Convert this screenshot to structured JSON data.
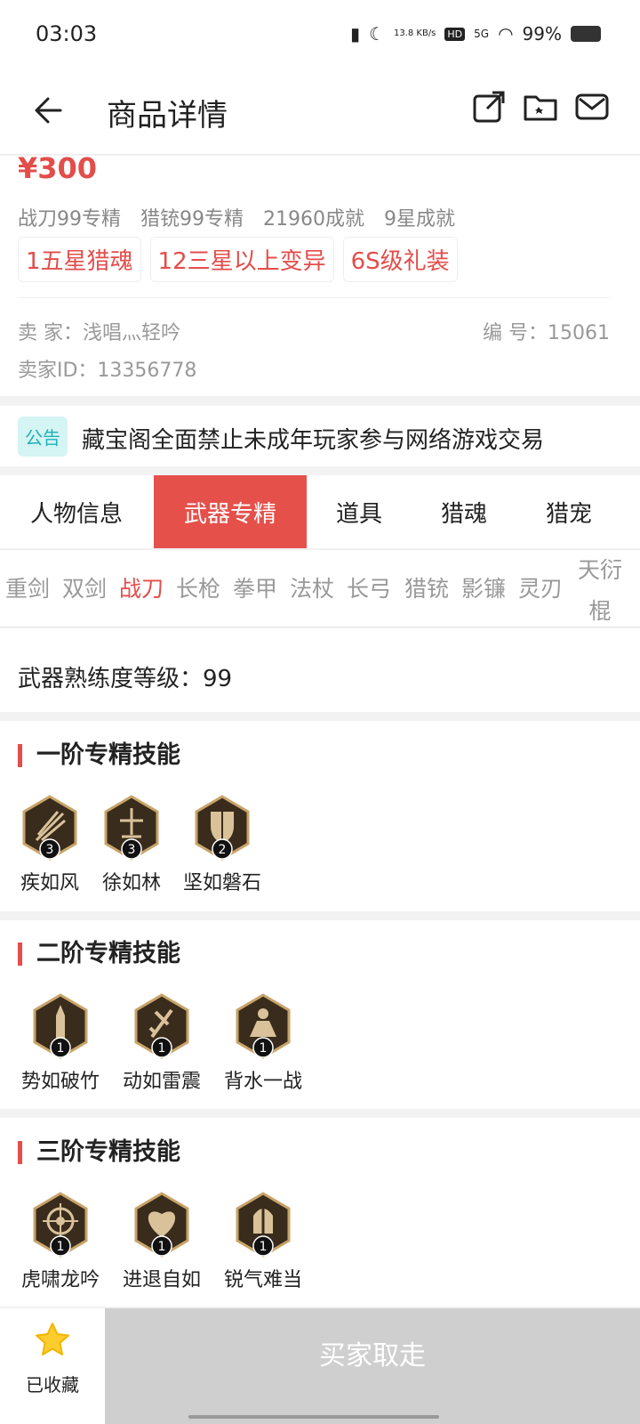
{
  "status": {
    "time": "03:03",
    "speed": "13.8\nKB/s",
    "hd": "HD",
    "net": "5G",
    "battery": "99%"
  },
  "header": {
    "title": "商品详情"
  },
  "item": {
    "price": "¥300",
    "specs": [
      "战刀99专精",
      "猎铳99专精",
      "21960成就",
      "9星成就"
    ],
    "tags": [
      "1五星猎魂",
      "12三星以上变异",
      "6S级礼装"
    ],
    "seller": "卖 家：浅唱灬轻吟",
    "serial": "编 号：15061",
    "seller_id": "卖家ID：13356778"
  },
  "notice": {
    "badge": "公告",
    "text": "藏宝阁全面禁止未成年玩家参与网络游戏交易"
  },
  "main_tabs": [
    "人物信息",
    "武器专精",
    "道具",
    "猎魂",
    "猎宠"
  ],
  "sub_tabs": [
    "重剑",
    "双剑",
    "战刀",
    "长枪",
    "拳甲",
    "法杖",
    "长弓",
    "猎铳",
    "影镰",
    "灵刃",
    "天衍棍"
  ],
  "mastery_level": "武器熟练度等级：99",
  "sections": [
    {
      "title": "一阶专精技能",
      "skills": [
        {
          "name": "疾如风",
          "level": "3"
        },
        {
          "name": "徐如林",
          "level": "3"
        },
        {
          "name": "坚如磐石",
          "level": "2"
        }
      ]
    },
    {
      "title": "二阶专精技能",
      "skills": [
        {
          "name": "势如破竹",
          "level": "1"
        },
        {
          "name": "动如雷震",
          "level": "1"
        },
        {
          "name": "背水一战",
          "level": "1"
        }
      ]
    },
    {
      "title": "三阶专精技能",
      "skills": [
        {
          "name": "虎啸龙吟",
          "level": "1"
        },
        {
          "name": "进退自如",
          "level": "1"
        },
        {
          "name": "锐气难当",
          "level": "1"
        }
      ]
    }
  ],
  "bottom": {
    "fav_label": "已收藏",
    "buy_label": "买家取走"
  },
  "colors": {
    "accent": "#e34d4a",
    "tab_active": "#e5504b",
    "notice": "#1fb2b8"
  }
}
